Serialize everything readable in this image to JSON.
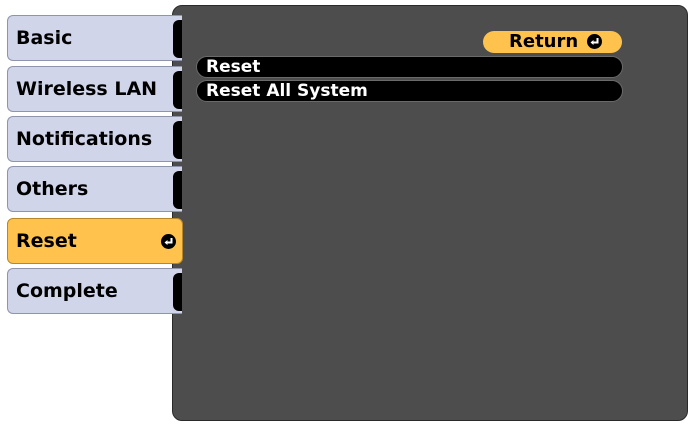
{
  "sidebar": {
    "items": [
      {
        "label": "Basic"
      },
      {
        "label": "Wireless LAN"
      },
      {
        "label": "Notifications"
      },
      {
        "label": "Others"
      },
      {
        "label": "Reset",
        "selected": true
      },
      {
        "label": "Complete"
      }
    ]
  },
  "main": {
    "return_label": "Return",
    "options": [
      {
        "label": "Reset"
      },
      {
        "label": "Reset All System"
      }
    ]
  },
  "colors": {
    "panel_bg": "#4d4d4d",
    "tab_bg": "#d1d5ea",
    "selected_bg": "#ffc34d",
    "row_bg": "#000000"
  },
  "icons": {
    "enter": "enter-icon"
  }
}
